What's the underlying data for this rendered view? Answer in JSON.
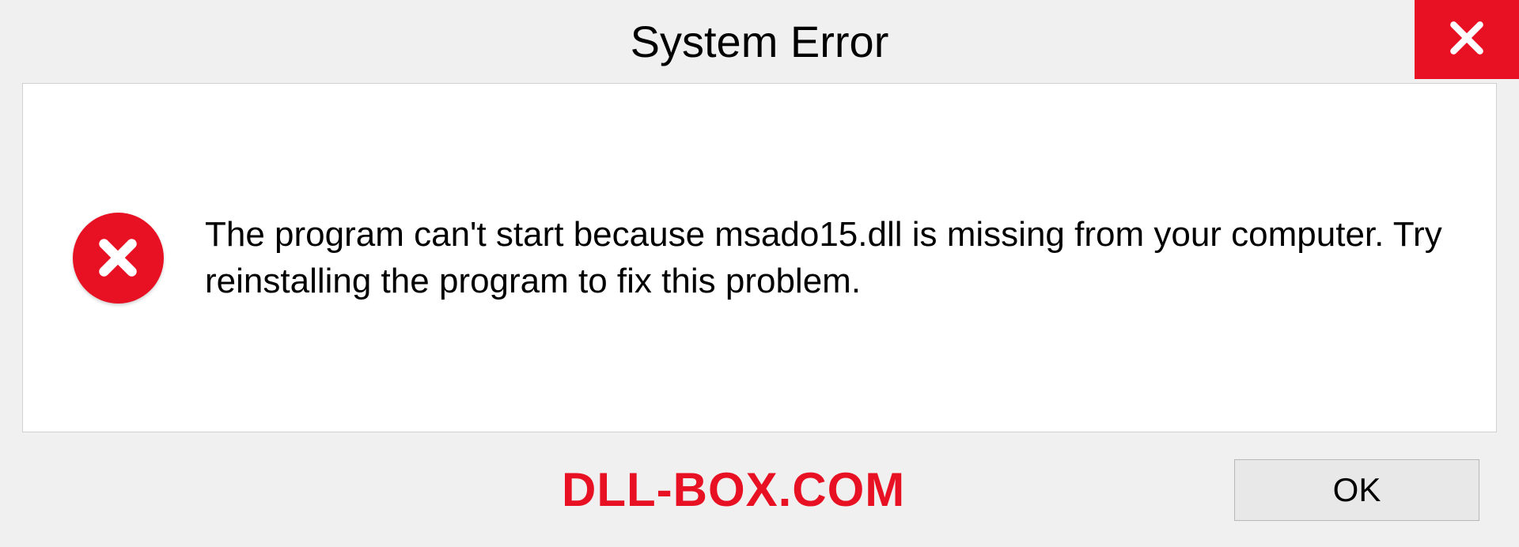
{
  "dialog": {
    "title": "System Error",
    "message": "The program can't start because msado15.dll is missing from your computer. Try reinstalling the program to fix this problem.",
    "ok_label": "OK"
  },
  "watermark": "DLL-BOX.COM",
  "colors": {
    "accent_red": "#e81123",
    "background": "#f0f0f0",
    "panel": "#ffffff"
  }
}
